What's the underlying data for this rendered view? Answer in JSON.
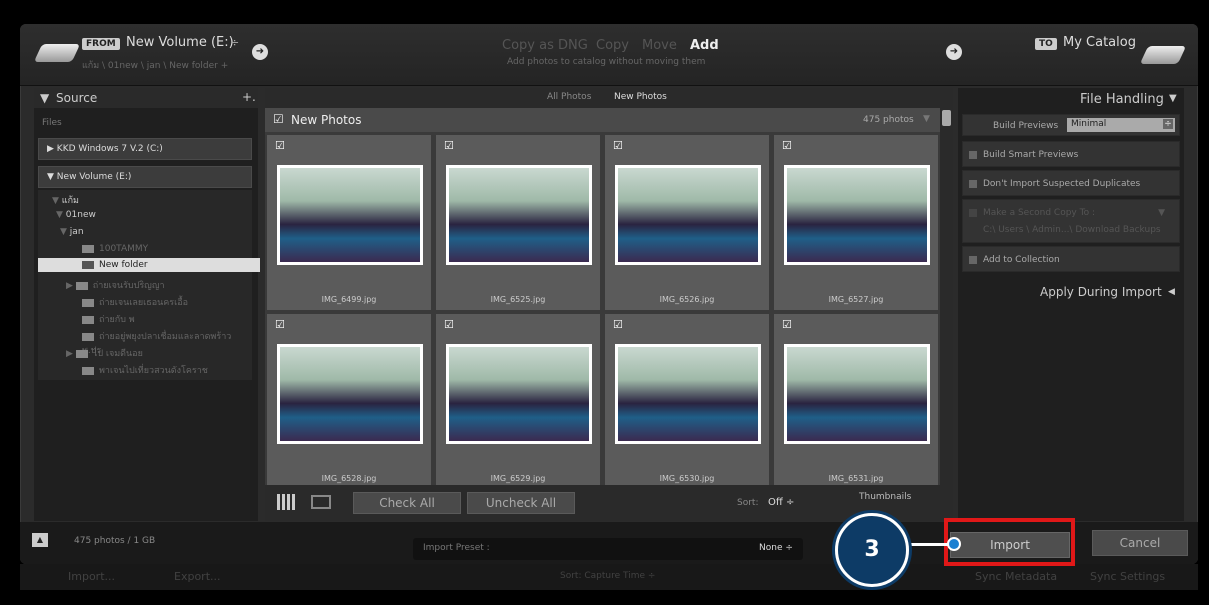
{
  "header": {
    "from_tag": "FROM",
    "source_volume": "New Volume (E:)",
    "source_path": "แก้ม \\ 01new \\ jan \\ New folder +",
    "modes": [
      "Copy as DNG",
      "Copy",
      "Move",
      "Add"
    ],
    "active_mode": "Add",
    "mode_desc": "Add photos to catalog without moving them",
    "to_tag": "TO",
    "destination": "My Catalog"
  },
  "source_panel": {
    "title": "Source",
    "plus": "+.",
    "files_label": "Files",
    "devices": [
      "KKD Windows 7 V.2 (C:)",
      "New Volume (E:)"
    ],
    "tree": [
      {
        "label": "แก้ม",
        "level": 1,
        "dim": false
      },
      {
        "label": "01new",
        "level": 2,
        "dim": false
      },
      {
        "label": "jan",
        "level": 3,
        "dim": false
      },
      {
        "label": "100TAMMY",
        "level": 4,
        "dim": true
      },
      {
        "label": "New folder",
        "level": 4,
        "dim": false,
        "selected": true
      },
      {
        "label": "ถ่ายเจนรับปริญญา",
        "level": 3,
        "dim": true
      },
      {
        "label": "ถ่ายเจนเลยเธอนครเอื้อ",
        "level": 3,
        "dim": true
      },
      {
        "label": "ถ่ายกับ พ",
        "level": 3,
        "dim": true
      },
      {
        "label": "ถ่ายอยู่พยุงปลาเชื่อมและลาดพร้าว พ.ปร",
        "level": 3,
        "dim": true
      },
      {
        "label": "ไป เจมดีนอย",
        "level": 3,
        "dim": true
      },
      {
        "label": "พาเจนไปเที่ยวสวนดังโคราช",
        "level": 3,
        "dim": true
      }
    ]
  },
  "grid": {
    "tabs": [
      "All Photos",
      "New Photos"
    ],
    "active_tab": "New Photos",
    "header_label": "New Photos",
    "count": "475 photos",
    "photos": [
      {
        "name": "IMG_6499.jpg"
      },
      {
        "name": "IMG_6525.jpg"
      },
      {
        "name": "IMG_6526.jpg"
      },
      {
        "name": "IMG_6527.jpg"
      },
      {
        "name": "IMG_6528.jpg"
      },
      {
        "name": "IMG_6529.jpg"
      },
      {
        "name": "IMG_6530.jpg"
      },
      {
        "name": "IMG_6531.jpg"
      }
    ],
    "check_all": "Check All",
    "uncheck_all": "Uncheck All",
    "sort_label": "Sort:",
    "sort_value": "Off ÷",
    "thumbnails_label": "Thumbnails"
  },
  "file_handling": {
    "title": "File Handling",
    "build_previews_label": "Build Previews",
    "build_previews_value": "Minimal",
    "options": [
      "Build Smart Previews",
      "Don't Import Suspected Duplicates"
    ],
    "second_copy": "Make a Second Copy To :",
    "second_copy_path": "C:\\ Users \\ Admin...\\ Download Backups",
    "add_collection": "Add to Collection",
    "apply_title": "Apply During Import"
  },
  "footer": {
    "summary": "475 photos / 1 GB",
    "import_preset_label": "Import Preset :",
    "import_preset_value": "None ÷",
    "import": "Import",
    "cancel": "Cancel",
    "step_number": "3",
    "under_import": "Import...",
    "under_export": "Export...",
    "under_sort": "Sort:  Capture Time ÷",
    "under_sync_meta": "Sync Metadata",
    "under_sync_settings": "Sync Settings"
  },
  "accent": {
    "highlight": "#e01818",
    "step_circle": "#0d3b66",
    "dot": "#1a7fd1"
  }
}
